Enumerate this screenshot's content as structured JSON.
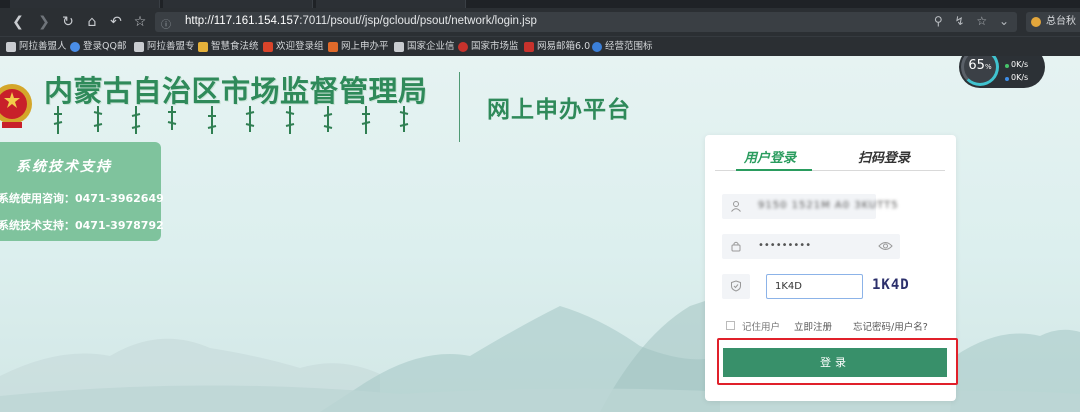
{
  "browser": {
    "url_host": "http://117.161.154.157",
    "url_path": ":7011/psout//jsp/gcloud/psout/network/login.jsp",
    "extension_label": "总台秋",
    "bookmarks": [
      "阿拉善盟人",
      "登录QQ邮",
      "阿拉善盟专",
      "智慧食法统",
      "欢迎登录组",
      "网上申办平",
      "国家企业信",
      "国家市场监",
      "网易邮箱6.0",
      "经营范围标"
    ]
  },
  "speed_widget": {
    "percent": "65",
    "percent_unit": "%",
    "up_rate": "0K/s",
    "down_rate": "0K/s"
  },
  "header": {
    "title": "内蒙古自治区市场监督管理局",
    "platform": "网上申办平台"
  },
  "support": {
    "title": "系统技术支持",
    "line1": "系统使用咨询：0471-3962649",
    "line2": "系统技术支持：0471-3978792"
  },
  "login": {
    "tab_user": "用户登录",
    "tab_qr": "扫码登录",
    "username_value": "9150 1521M A0 3KUTT5",
    "password_value": "•••••••••",
    "captcha_value": "1K4D",
    "captcha_image_text": "1K4D",
    "remember_label": "记住用户",
    "register_label": "立即注册",
    "forgot_label": "忘记密码/用户名?",
    "submit_label": "登录"
  },
  "colors": {
    "brand_green": "#2f8a5a",
    "button_green": "#38906a",
    "highlight_red": "#e0202a"
  }
}
